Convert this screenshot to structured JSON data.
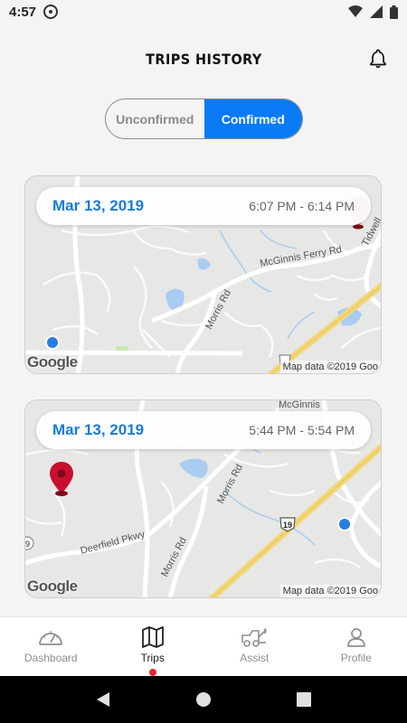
{
  "status_bar": {
    "time": "4:57",
    "icons": [
      "app-notification-icon",
      "wifi-icon",
      "signal-icon",
      "battery-icon"
    ]
  },
  "header": {
    "title": "TRIPS HISTORY",
    "bell_icon": "bell-icon"
  },
  "toggle": {
    "unconfirmed_label": "Unconfirmed",
    "confirmed_label": "Confirmed",
    "selected": "Confirmed"
  },
  "trips": [
    {
      "date": "Mar 13, 2019",
      "time_range": "6:07 PM - 6:14 PM",
      "map": {
        "labels": [
          "McGinnis Ferry Rd",
          "Morris Rd",
          "Tidwell"
        ],
        "google": "Google",
        "map_data": "Map data ©2019 Goo"
      }
    },
    {
      "date": "Mar 13, 2019",
      "time_range": "5:44 PM - 5:54 PM",
      "map": {
        "labels": [
          "McGinnis",
          "Morris Rd",
          "Deerfield Pkwy",
          "Morris Rd",
          "19",
          "9"
        ],
        "google": "Google",
        "map_data": "Map data ©2019 Goo"
      }
    }
  ],
  "bottom_nav": {
    "items": [
      {
        "label": "Dashboard",
        "icon": "speedometer-icon"
      },
      {
        "label": "Trips",
        "icon": "map-icon"
      },
      {
        "label": "Assist",
        "icon": "tow-truck-icon"
      },
      {
        "label": "Profile",
        "icon": "person-icon"
      }
    ],
    "active": "Trips"
  },
  "colors": {
    "accent": "#0a7af5",
    "date_blue": "#1a7ad8",
    "active_dot": "#e8262b",
    "pin_red": "#c8102e"
  }
}
